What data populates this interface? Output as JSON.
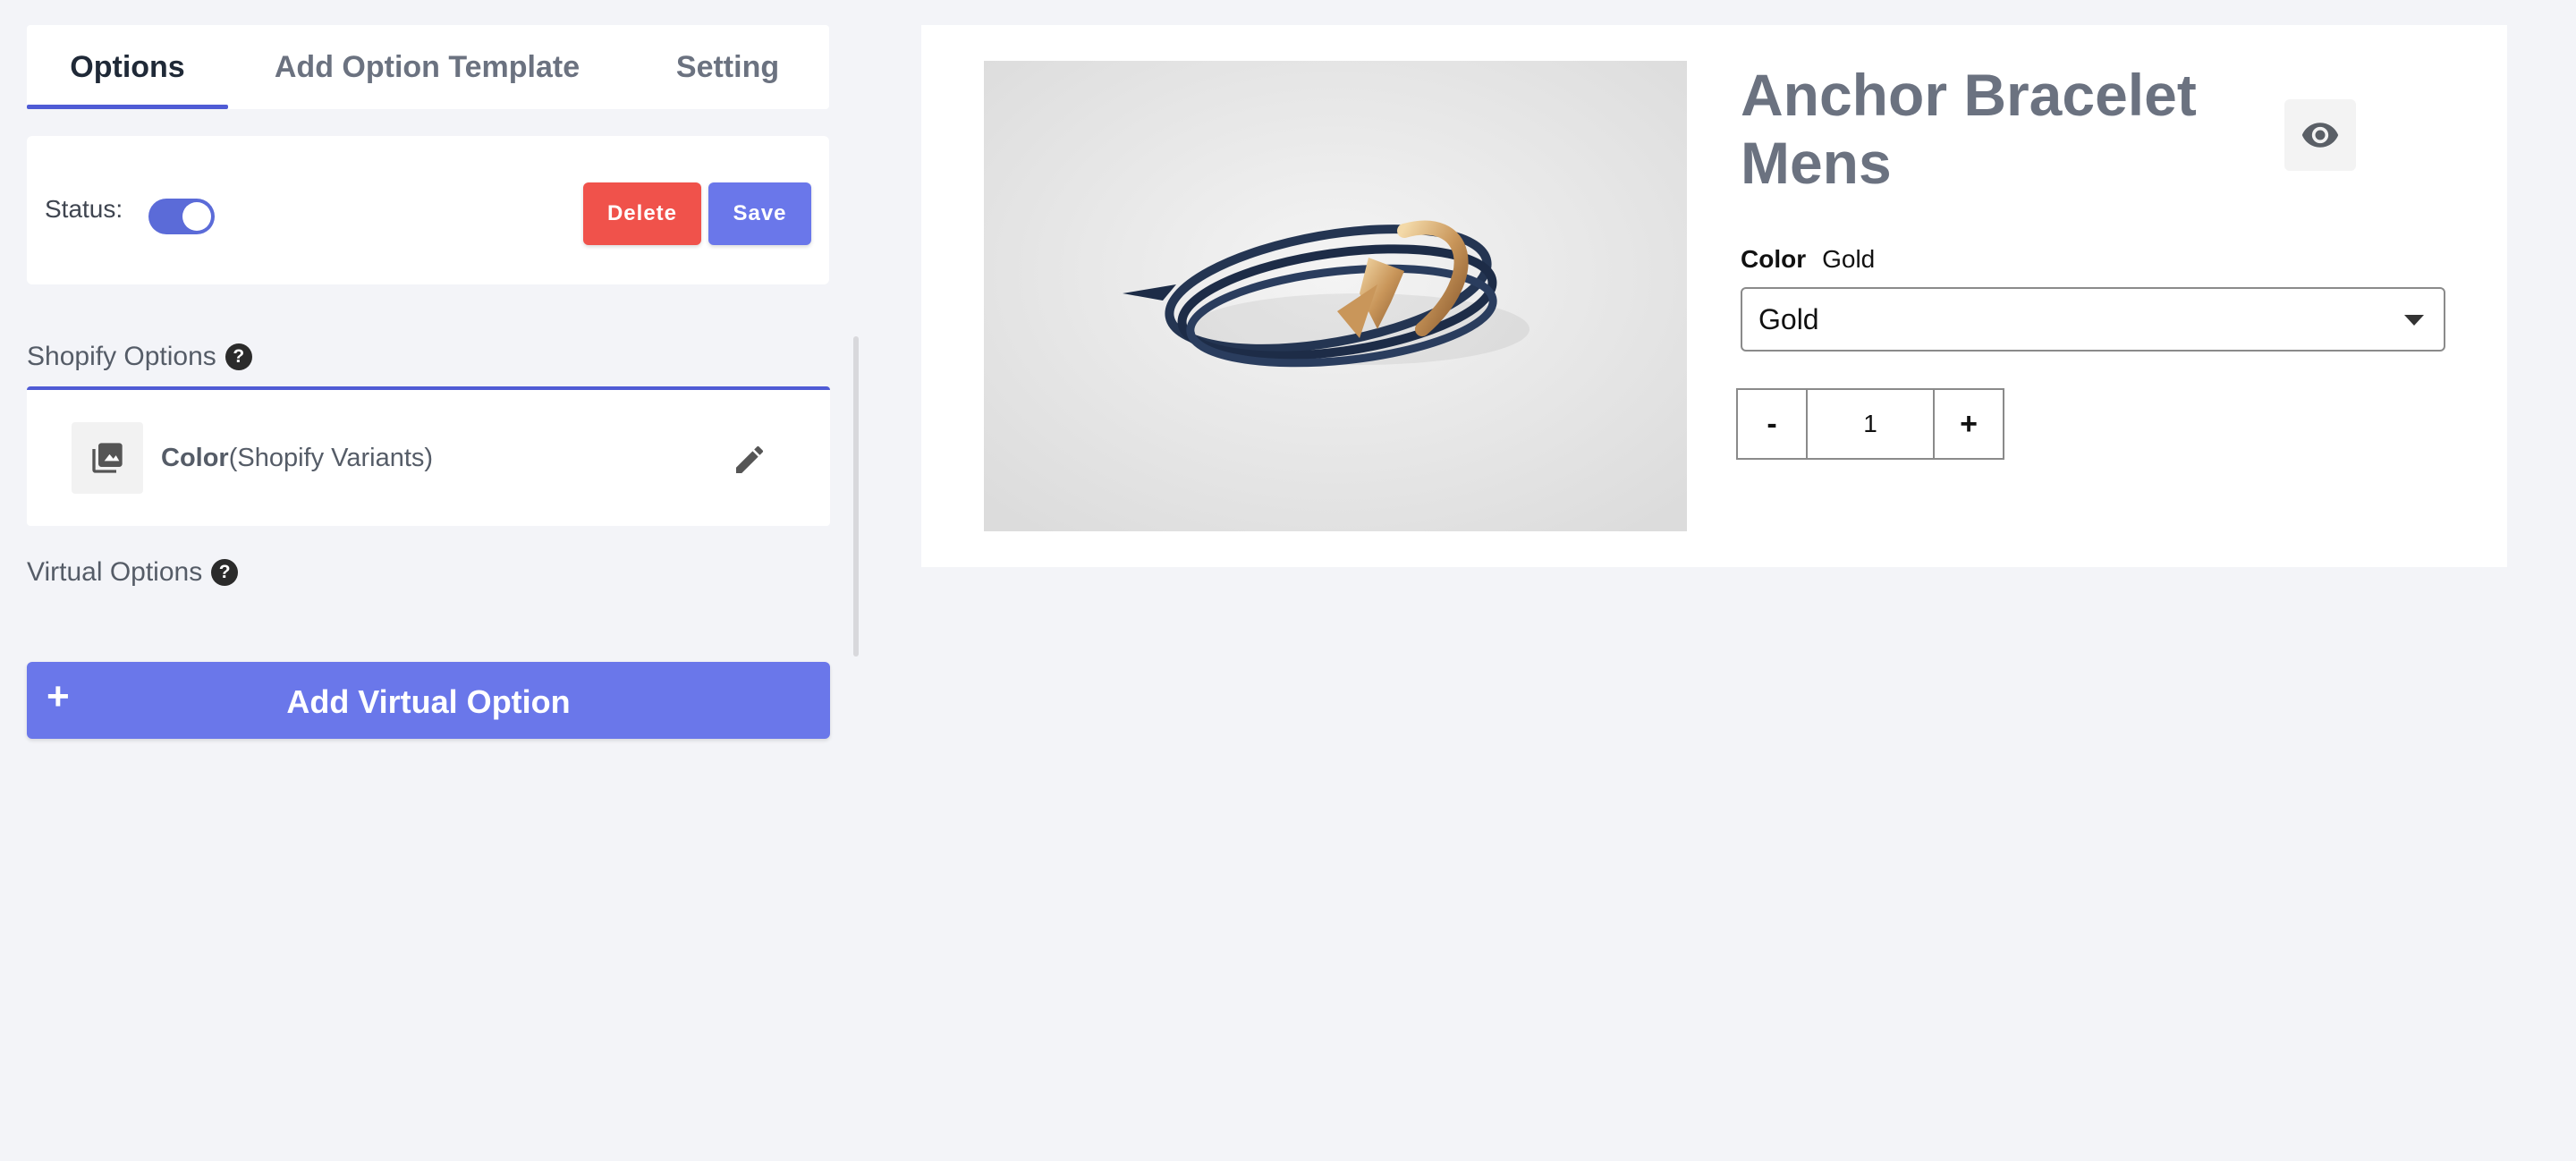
{
  "tabs": [
    {
      "label": "Options",
      "active": true
    },
    {
      "label": "Add Option Template",
      "active": false
    },
    {
      "label": "Setting",
      "active": false
    }
  ],
  "status": {
    "label": "Status:",
    "enabled": true,
    "delete_label": "Delete",
    "save_label": "Save"
  },
  "shopify_options": {
    "title": "Shopify Options",
    "help": "?",
    "items": [
      {
        "name": "Color",
        "suffix": "(Shopify Variants)",
        "icon": "copy-layers-icon"
      }
    ]
  },
  "virtual_options": {
    "title": "Virtual Options",
    "help": "?",
    "add_label": "Add Virtual Option",
    "add_plus": "+"
  },
  "preview": {
    "title": "Anchor Bracelet Mens",
    "color_label": "Color",
    "color_value": "Gold",
    "select_value": "Gold",
    "qty_minus": "-",
    "qty_value": "1",
    "qty_plus": "+"
  },
  "colors": {
    "accent": "#4f5bd5",
    "button_primary": "#6a77ea",
    "button_delete": "#f0524b",
    "background": "#f3f4f8"
  }
}
